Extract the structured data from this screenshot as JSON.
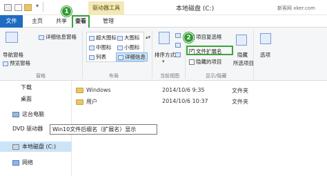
{
  "titlebar": {
    "context_tab": "驱动器工具",
    "window_title": "本地磁盘 (C:)",
    "watermark": "新客网 xker.com"
  },
  "tabs": {
    "file": "文件",
    "home": "主页",
    "share": "共享",
    "view": "查看",
    "manage": "管理"
  },
  "ribbon": {
    "pane_group": {
      "nav_pane": "导航窗格",
      "preview_pane": "预览窗格",
      "details_pane": "详细信息窗格",
      "label": "窗格"
    },
    "layout_group": {
      "items": [
        "超大图标",
        "大图标",
        "中图标",
        "小图标",
        "列表",
        "详细信息"
      ],
      "label": "布局"
    },
    "current_view_group": {
      "sort": "排序方式",
      "label": "当前视图"
    },
    "show_hide_group": {
      "item_checkbox": "项目复选框",
      "file_ext": "文件扩展名",
      "hidden_items": "隐藏的项目",
      "hide_selected": "隐藏",
      "hide_selected_2": "所选项目",
      "label": "显示/隐藏"
    },
    "options": "选项"
  },
  "badges": {
    "one": "1",
    "two": "2"
  },
  "nav": {
    "items": [
      "下载",
      "桌面",
      "这台电脑",
      "DVD 驱动器",
      "本地磁盘 (C:)",
      "网络"
    ]
  },
  "files": [
    {
      "name": "Windows",
      "date": "2014/10/6 9:35",
      "type": "文件夹"
    },
    {
      "name": "用户",
      "date": "2014/10/6 10:37",
      "type": "文件夹"
    }
  ],
  "tooltip": "Win10文件后缀名（扩展名）显示",
  "colors": {
    "accent": "#1e6cc1",
    "highlight": "#3aa33a",
    "selected": "#cce4f7"
  }
}
